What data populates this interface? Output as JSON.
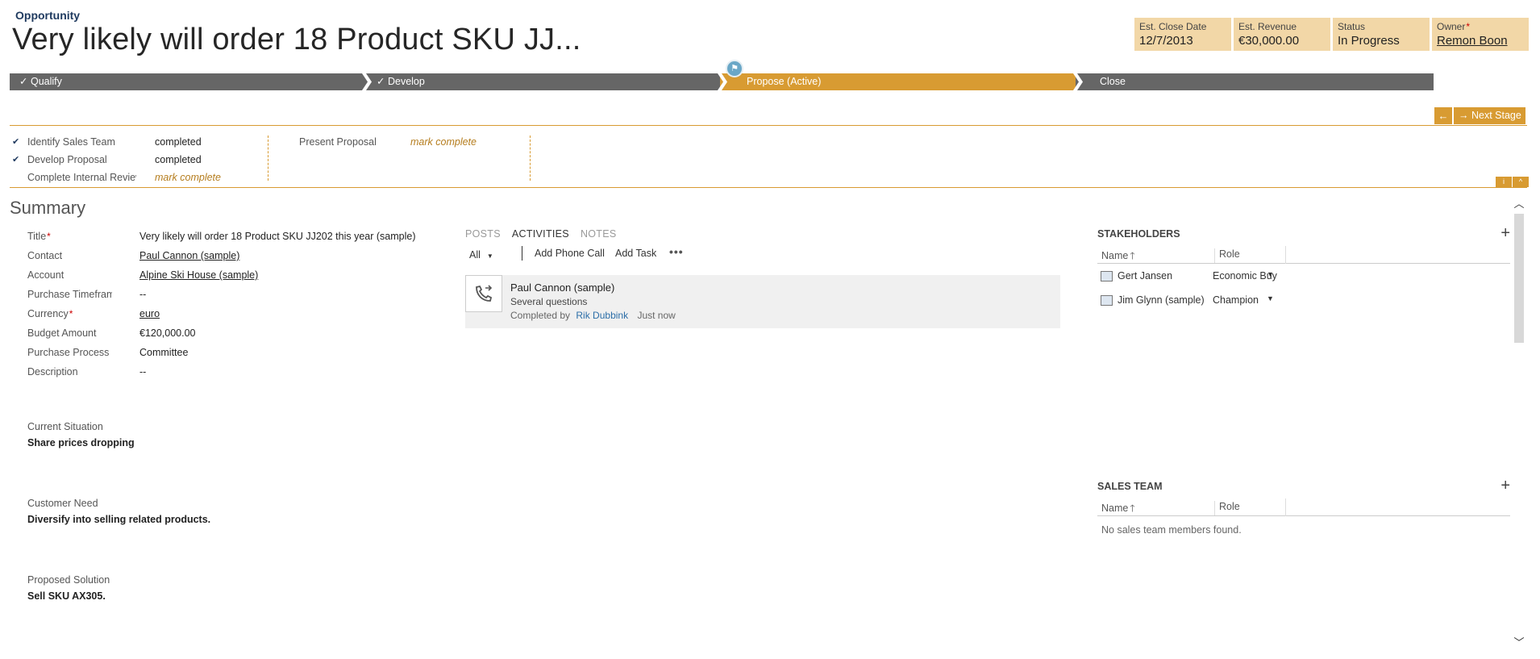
{
  "header": {
    "entity_type": "Opportunity",
    "title": "Very likely will order 18 Product SKU JJ...",
    "fields": [
      {
        "label": "Est. Close Date",
        "value": "12/7/2013"
      },
      {
        "label": "Est. Revenue",
        "value": "€30,000.00"
      },
      {
        "label": "Status",
        "value": "In Progress"
      },
      {
        "label": "Owner",
        "value": "Remon Boon",
        "required": "*"
      }
    ]
  },
  "process": {
    "stages": [
      {
        "label": "Qualify",
        "check": "✓"
      },
      {
        "label": "Develop",
        "check": "✓"
      },
      {
        "label": "Propose (Active)"
      },
      {
        "label": "Close"
      }
    ],
    "flag_icon": "flag-icon",
    "nav": {
      "back_icon": "🡐",
      "next_label": "Next Stage",
      "next_icon": "🡒"
    },
    "steps_left": [
      {
        "check": "✔",
        "name": "Identify Sales Team",
        "value": "completed"
      },
      {
        "check": "✔",
        "name": "Develop Proposal",
        "value": "completed"
      },
      {
        "check": "",
        "name": "Complete Internal Review",
        "value": "mark complete"
      }
    ],
    "steps_right": [
      {
        "name": "Present Proposal",
        "value": "mark complete"
      }
    ],
    "mini_buttons": [
      "i",
      "^"
    ],
    "active_color": "#d89b32",
    "inactive_color": "#666666"
  },
  "summary": {
    "heading": "Summary",
    "fields": [
      {
        "label": "Title",
        "value": "Very likely will order 18 Product SKU JJ202 this year (sample)",
        "required": "*"
      },
      {
        "label": "Contact",
        "value": "Paul Cannon (sample)"
      },
      {
        "label": "Account",
        "value": "Alpine Ski House (sample)"
      },
      {
        "label": "Purchase Timeframe",
        "value": "--"
      },
      {
        "label": "Currency",
        "value": "euro",
        "required": "*"
      },
      {
        "label": "Budget Amount",
        "value": "€120,000.00"
      },
      {
        "label": "Purchase Process",
        "value": "Committee"
      },
      {
        "label": "Description",
        "value": "--"
      }
    ],
    "current_situation": {
      "label": "Current Situation",
      "value": "Share prices dropping"
    },
    "customer_need": {
      "label": "Customer Need",
      "value": "Diversify into selling related products."
    },
    "proposed_solution": {
      "label": "Proposed Solution",
      "value": "Sell SKU AX305."
    }
  },
  "social": {
    "tabs": [
      "POSTS",
      "ACTIVITIES",
      "NOTES"
    ],
    "filter": "All",
    "add_phone_call": "Add Phone Call",
    "add_task": "Add Task",
    "more": "•••",
    "activity": {
      "title": "Paul Cannon (sample)",
      "subject": "Several questions",
      "completed_by_label": "Completed by",
      "completed_by": "Rik Dubbink",
      "when": "Just now"
    }
  },
  "stakeholders": {
    "title": "STAKEHOLDERS",
    "add": "+",
    "col_name": "Name",
    "col_role": "Role",
    "rows": [
      {
        "name": "Gert Jansen",
        "role": "Economic Buyer"
      },
      {
        "name": "Jim Glynn (sample)",
        "role": "Champion"
      }
    ]
  },
  "sales_team": {
    "title": "SALES TEAM",
    "add": "+",
    "col_name": "Name",
    "col_role": "Role",
    "empty": "No sales team members found."
  }
}
